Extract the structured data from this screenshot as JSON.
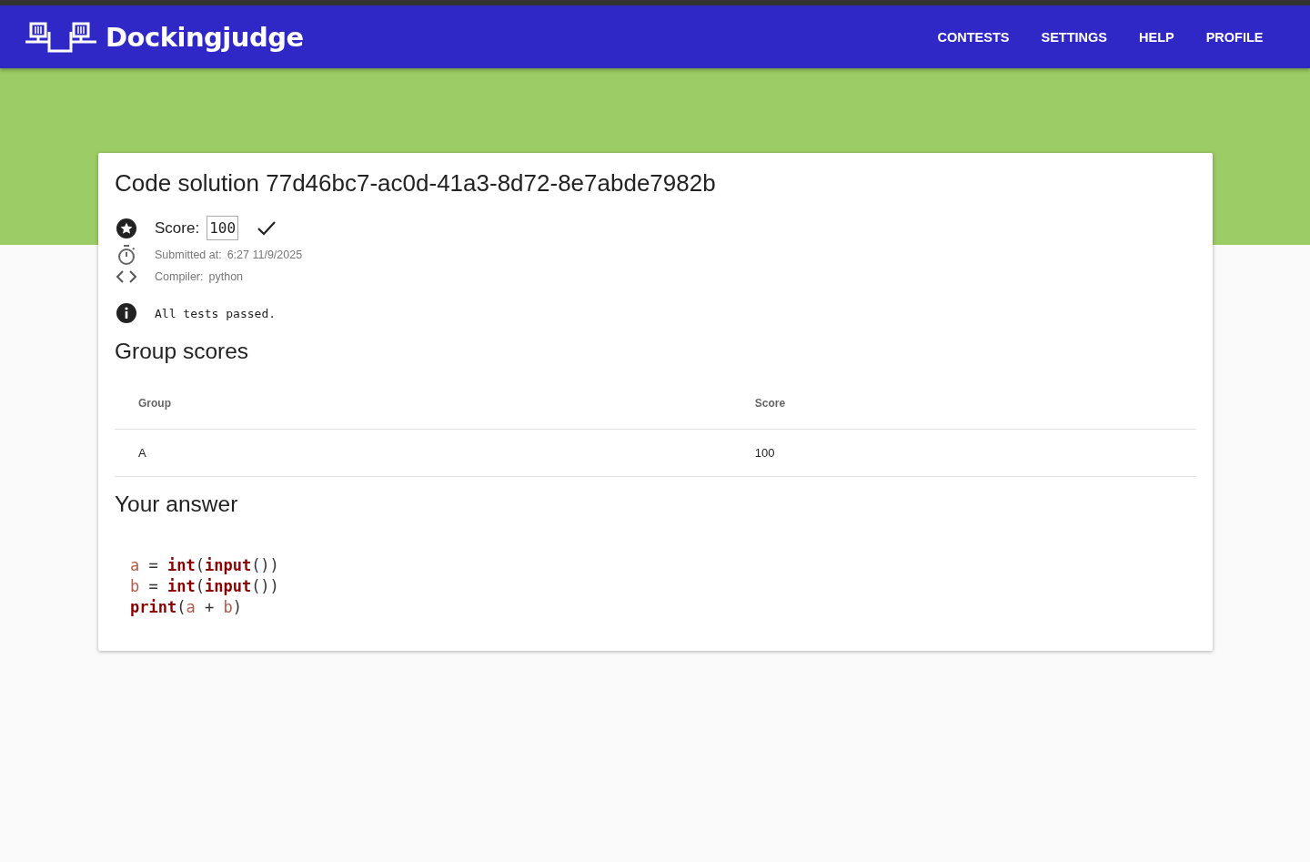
{
  "header": {
    "brand": "Dockingjudge",
    "nav": [
      "CONTESTS",
      "SETTINGS",
      "HELP",
      "PROFILE"
    ]
  },
  "solution": {
    "title": "Code solution 77d46bc7-ac0d-41a3-8d72-8e7abde7982b",
    "score_label": "Score:",
    "score": "100",
    "passed": true,
    "submitted_label": "Submitted at:",
    "submitted": "6:27 11/9/2025",
    "compiler_label": "Compiler:",
    "compiler": "python",
    "message": "All tests passed."
  },
  "group_scores": {
    "title": "Group scores",
    "columns": [
      "Group",
      "Score"
    ],
    "rows": [
      [
        "A",
        "100"
      ]
    ]
  },
  "answer": {
    "title": "Your answer",
    "lines": [
      [
        {
          "text": "a",
          "kind": "var"
        },
        {
          "text": " = ",
          "kind": "op"
        },
        {
          "text": "int",
          "kind": "builtin"
        },
        {
          "text": "(",
          "kind": "paren"
        },
        {
          "text": "input",
          "kind": "builtin"
        },
        {
          "text": "())",
          "kind": "paren"
        }
      ],
      [
        {
          "text": "b",
          "kind": "var"
        },
        {
          "text": " = ",
          "kind": "op"
        },
        {
          "text": "int",
          "kind": "builtin"
        },
        {
          "text": "(",
          "kind": "paren"
        },
        {
          "text": "input",
          "kind": "builtin"
        },
        {
          "text": "())",
          "kind": "paren"
        }
      ],
      [
        {
          "text": "print",
          "kind": "builtin"
        },
        {
          "text": "(",
          "kind": "paren"
        },
        {
          "text": "a",
          "kind": "var"
        },
        {
          "text": " + ",
          "kind": "op"
        },
        {
          "text": "b",
          "kind": "var"
        },
        {
          "text": ")",
          "kind": "paren"
        }
      ]
    ]
  }
}
